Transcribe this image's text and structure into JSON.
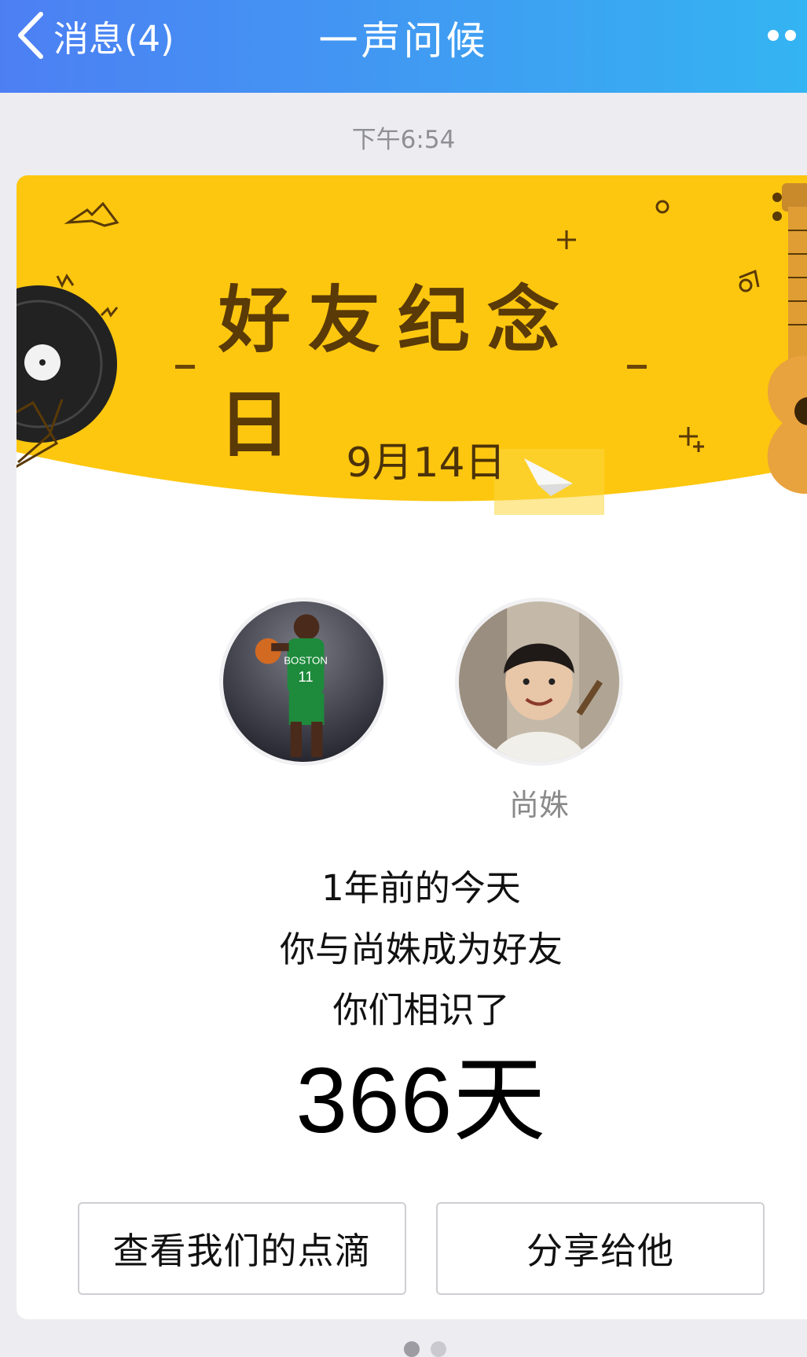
{
  "header": {
    "back_label": "消息(4)",
    "title": "一声问候"
  },
  "timestamp": "下午6:54",
  "card": {
    "banner_title": "好友纪念日",
    "banner_date": "9月14日",
    "friend_name": "尚姝",
    "line1": "1年前的今天",
    "line2": "你与尚姝成为好友",
    "line3": "你们相识了",
    "days": "366天",
    "buttons": {
      "view_memories": "查看我们的点滴",
      "share": "分享给他"
    }
  },
  "colors": {
    "header_start": "#4d7ff3",
    "header_end": "#34b4f2",
    "banner_yellow": "#fdc70f"
  },
  "pager": {
    "pages": 2,
    "active": 1
  }
}
